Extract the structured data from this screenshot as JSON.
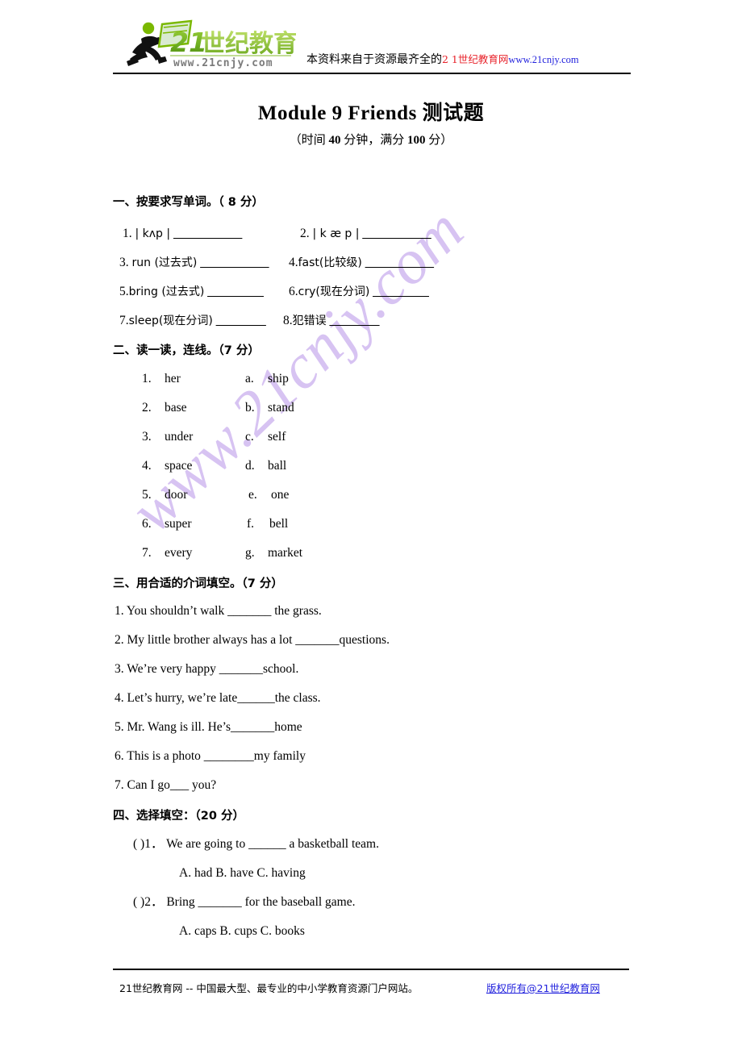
{
  "header": {
    "logo_name": "21世纪教育",
    "logo_url_text": "www.21cnjy.com",
    "note_prefix": "本资料来自于资源最齐全的",
    "note_brand": "2 1世纪教育网",
    "note_link": "www.21cnjy.com"
  },
  "watermark": "www.21cnjy.com",
  "doc": {
    "title": "Module 9    Friends  测试题",
    "subtitle_open": "（时间 ",
    "subtitle_minutes": "40",
    "subtitle_mid": " 分钟，满分 ",
    "subtitle_score": "100",
    "subtitle_close": " 分）"
  },
  "sections": [
    {
      "heading": "一、按要求写单词。（ 8 分）",
      "items": [
        {
          "num": "1.",
          "prompt": "| kʌp |",
          "blank": "___________"
        },
        {
          "num": "2.",
          "prompt": "| k æ p |",
          "blank": "___________"
        },
        {
          "num": "3.",
          "prompt": "run (过去式)",
          "blank": "___________"
        },
        {
          "num": "4.",
          "prompt": "fast(比较级)",
          "blank": "___________"
        },
        {
          "num": "5.",
          "prompt": "bring (过去式)",
          "blank": "_________"
        },
        {
          "num": "6.",
          "prompt": "cry(现在分词)",
          "blank": "_________"
        },
        {
          "num": "7.",
          "prompt": "sleep(现在分词)",
          "blank": "________"
        },
        {
          "num": "8.",
          "prompt": "犯错误",
          "blank": "________"
        }
      ]
    },
    {
      "heading": "二、读一读，连线。（7 分）",
      "left": [
        {
          "num": "1.",
          "word": "her"
        },
        {
          "num": "2.",
          "word": "base"
        },
        {
          "num": "3.",
          "word": "under"
        },
        {
          "num": "4.",
          "word": "space"
        },
        {
          "num": "5.",
          "word": "door"
        },
        {
          "num": "6.",
          "word": "super"
        },
        {
          "num": "7.",
          "word": "every"
        }
      ],
      "right": [
        {
          "num": "a.",
          "word": "ship"
        },
        {
          "num": "b.",
          "word": "stand"
        },
        {
          "num": "c.",
          "word": "self"
        },
        {
          "num": "d.",
          "word": "ball"
        },
        {
          "num": "e.",
          "word": "one"
        },
        {
          "num": "f.",
          "word": "bell"
        },
        {
          "num": "g.",
          "word": "market"
        }
      ]
    },
    {
      "heading": "三、用合适的介词填空。（7 分）",
      "questions": [
        "1. You shouldn’t walk  _______  the grass.",
        "2. My little brother always has a lot  _______questions.",
        "3. We’re very happy _______school.",
        "4. Let’s hurry, we’re late______the class.",
        "5. Mr. Wang is ill. He’s_______home",
        "6. This is a photo ________my family",
        "7. Can I go___    you?"
      ]
    },
    {
      "heading": "四、选择填空：（20 分）",
      "questions": [
        {
          "bracket": "(      )1．",
          "stem": "We are going to ______ a basketball team.",
          "options": "A. had          B. have       C. having"
        },
        {
          "bracket": "(      )2．",
          "stem": "Bring _______ for the baseball game.",
          "options": "A. caps        B. cups        C. books"
        }
      ]
    }
  ],
  "footer": {
    "text": "21世纪教育网  --  中国最大型、最专业的中小学教育资源门户网站。",
    "link": "版权所有@21世纪教育网"
  },
  "colors": {
    "brand_red": "#e8222a",
    "link_blue": "#2222dd",
    "watermark_purple": "#d7c3f2",
    "logo_green": "#7ab800"
  }
}
